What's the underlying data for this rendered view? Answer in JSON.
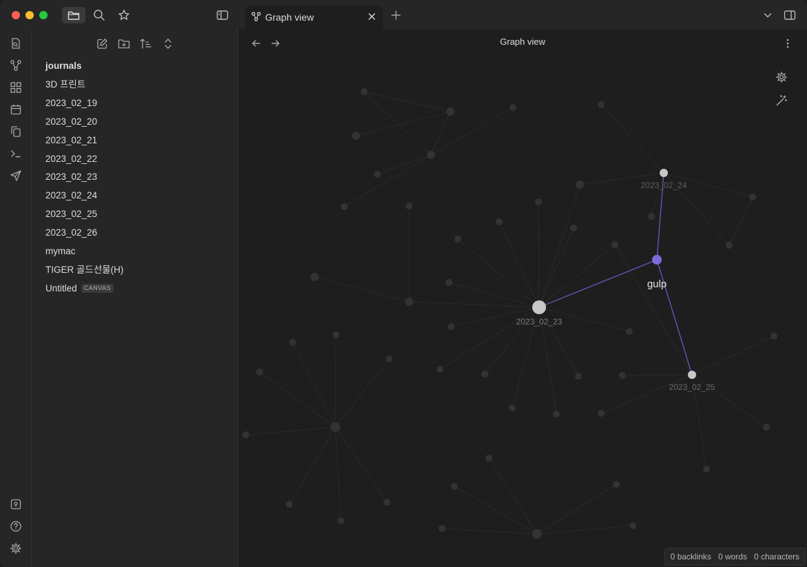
{
  "titlebar": {
    "tab_title": "Graph view",
    "tab_icon": "graph-icon"
  },
  "sidebar": {
    "files": [
      {
        "label": "journals",
        "bold": true
      },
      {
        "label": "3D 프린트"
      },
      {
        "label": "2023_02_19"
      },
      {
        "label": "2023_02_20"
      },
      {
        "label": "2023_02_21"
      },
      {
        "label": "2023_02_22"
      },
      {
        "label": "2023_02_23"
      },
      {
        "label": "2023_02_24"
      },
      {
        "label": "2023_02_25"
      },
      {
        "label": "2023_02_26"
      },
      {
        "label": "mymac"
      },
      {
        "label": "TIGER 골드선물(H)"
      },
      {
        "label": "Untitled",
        "badge": "CANVAS"
      }
    ]
  },
  "main": {
    "view_title": "Graph view"
  },
  "graph": {
    "active_node": "gulp",
    "active_color": "#7b6cd9",
    "nodes": {
      "n_2023_02_23": "2023_02_23",
      "n_2023_02_24": "2023_02_24",
      "n_2023_02_25": "2023_02_25",
      "n_gulp": "gulp"
    }
  },
  "status": {
    "backlinks": "0 backlinks",
    "words": "0 words",
    "characters": "0 characters"
  }
}
